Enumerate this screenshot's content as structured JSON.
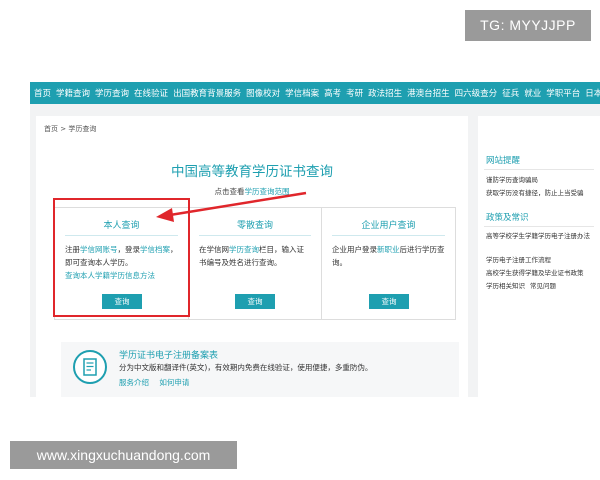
{
  "watermark_top": "TG: MYYJJPP",
  "watermark_bottom": "www.xingxuchuandong.com",
  "nav": [
    "首页",
    "学籍查询",
    "学历查询",
    "在线验证",
    "出国教育背景服务",
    "图像校对",
    "学信档案",
    "高考",
    "考研",
    "政法招生",
    "港澳台招生",
    "四六级查分",
    "征兵",
    "就业",
    "学职平台",
    "日本频道"
  ],
  "breadcrumb": {
    "home": "首页",
    "sep": ">",
    "current": "学历查询"
  },
  "main": {
    "title": "中国高等教育学历证书查询",
    "sub_prefix": "点击查看",
    "sub_link": "学历查询范围",
    "cards": [
      {
        "title": "本人查询",
        "t1": "注册",
        "l1": "学信网账号",
        "t2": "，登录",
        "l2": "学信档案",
        "t3": "，即可查询本人学历。",
        "l3": "查询本人学籍学历信息方法",
        "button": "查询"
      },
      {
        "title": "零散查询",
        "t1": "在学信网",
        "l1": "学历查询",
        "t2": "栏目，输入证书编号及姓名进行查询。",
        "button": "查询"
      },
      {
        "title": "企业用户查询",
        "t1": "企业用户登录",
        "l1": "新职业",
        "t2": "后进行学历查询。",
        "button": "查询"
      }
    ],
    "banner": {
      "title": "学历证书电子注册备案表",
      "desc": "分为中文版和翻译件(英文)，有效期内免费在线验证，使用便捷，多重防伪。",
      "links": [
        "服务介绍",
        "如何申请"
      ]
    }
  },
  "sidebar": {
    "section1": {
      "title": "网站提醒",
      "items": [
        "谨防学历查询骗局",
        "获取学历没有捷径，防止上当受骗"
      ]
    },
    "section2": {
      "title": "政策及常识",
      "items": [
        "高等学校学生学籍学历电子注册办法",
        "学历电子注册工作流程",
        "高校学生获得学籍及毕业证书政策",
        "学历相关知识",
        "常见问题"
      ]
    }
  },
  "colors": {
    "accent": "#1e9fb0",
    "highlight": "#e0262b"
  }
}
